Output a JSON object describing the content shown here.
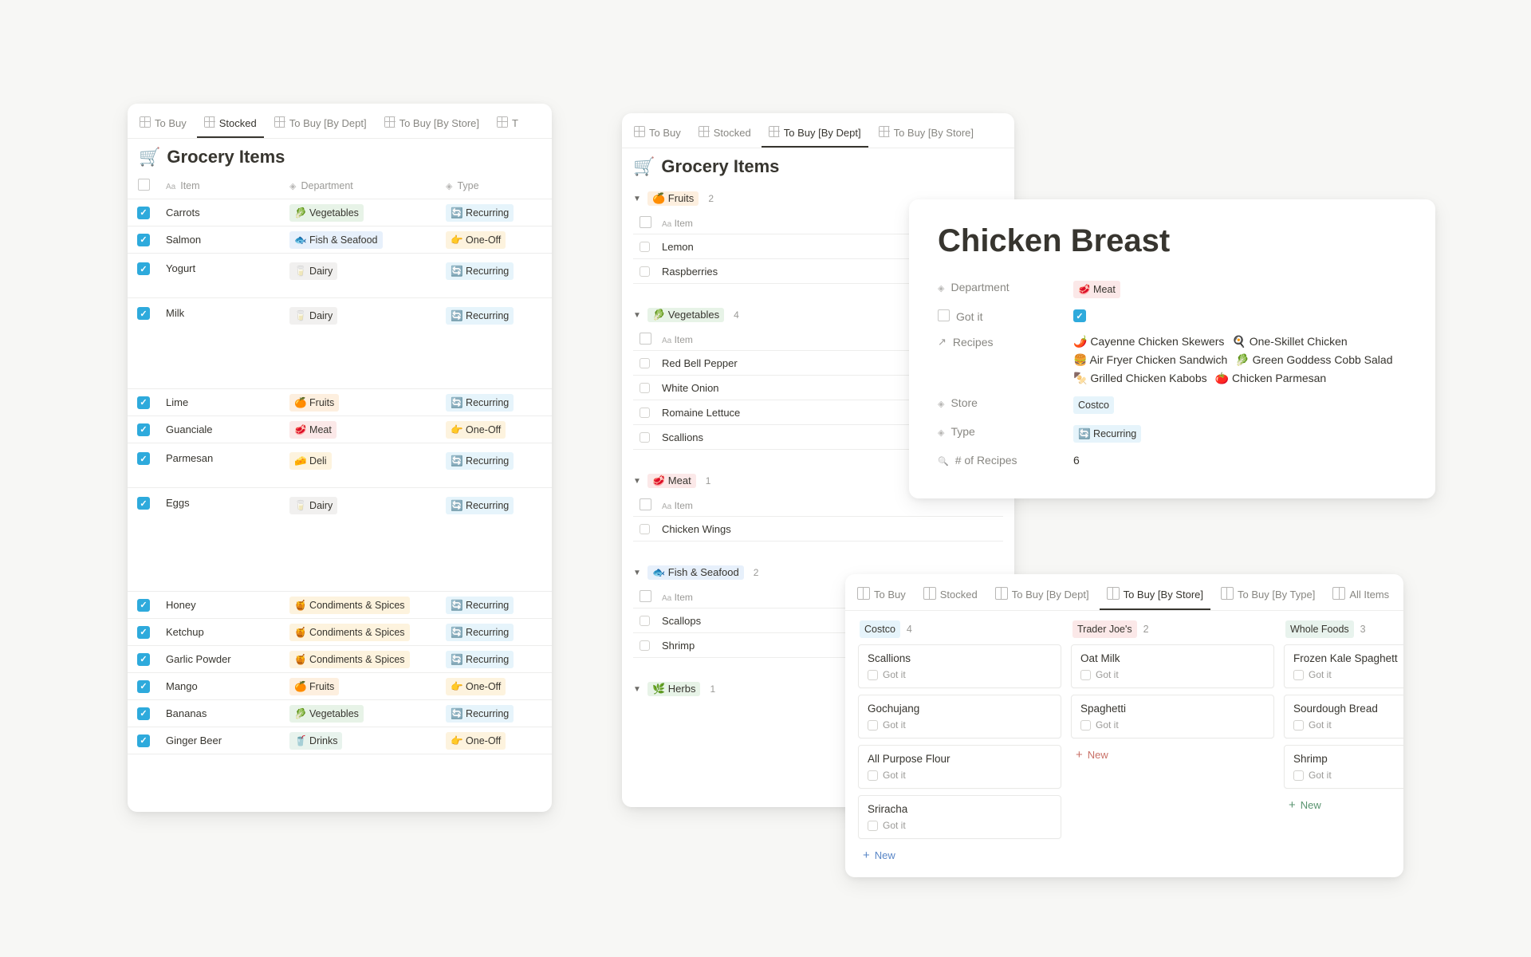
{
  "shared": {
    "title_emoji": "🛒",
    "title_text": "Grocery Items",
    "item_header": "Item",
    "got_it_label": "Got it",
    "new_label": "New"
  },
  "panel_stocked": {
    "tabs": [
      {
        "label": "To Buy",
        "active": false
      },
      {
        "label": "Stocked",
        "active": true
      },
      {
        "label": "To Buy [By Dept]",
        "active": false
      },
      {
        "label": "To Buy [By Store]",
        "active": false
      },
      {
        "label": "T",
        "active": false
      }
    ],
    "headers": {
      "item": "Item",
      "department": "Department",
      "type": "Type"
    },
    "rows": [
      {
        "checked": true,
        "item": "Carrots",
        "dept_emoji": "🥬",
        "dept": "Vegetables",
        "dept_class": "tag-vegetables",
        "type_emoji": "🔄",
        "type": "Recurring",
        "type_class": "tag-recurring"
      },
      {
        "checked": true,
        "item": "Salmon",
        "dept_emoji": "🐟",
        "dept": "Fish & Seafood",
        "dept_class": "tag-fish",
        "type_emoji": "👉",
        "type": "One-Off",
        "type_class": "tag-oneoff"
      },
      {
        "checked": true,
        "item": "Yogurt",
        "dept_emoji": "🥛",
        "dept": "Dairy",
        "dept_class": "tag-dairy",
        "type_emoji": "🔄",
        "type": "Recurring",
        "type_class": "tag-recurring",
        "row_class": "tall-med"
      },
      {
        "checked": true,
        "item": "Milk",
        "dept_emoji": "🥛",
        "dept": "Dairy",
        "dept_class": "tag-dairy",
        "type_emoji": "🔄",
        "type": "Recurring",
        "type_class": "tag-recurring",
        "row_class": "tall-2"
      },
      {
        "checked": true,
        "item": "Lime",
        "dept_emoji": "🍊",
        "dept": "Fruits",
        "dept_class": "tag-fruits",
        "type_emoji": "🔄",
        "type": "Recurring",
        "type_class": "tag-recurring"
      },
      {
        "checked": true,
        "item": "Guanciale",
        "dept_emoji": "🥩",
        "dept": "Meat",
        "dept_class": "tag-meat",
        "type_emoji": "👉",
        "type": "One-Off",
        "type_class": "tag-oneoff"
      },
      {
        "checked": true,
        "item": "Parmesan",
        "dept_emoji": "🧀",
        "dept": "Deli",
        "dept_class": "tag-deli",
        "type_emoji": "🔄",
        "type": "Recurring",
        "type_class": "tag-recurring",
        "row_class": "tall-med"
      },
      {
        "checked": true,
        "item": "Eggs",
        "dept_emoji": "🥛",
        "dept": "Dairy",
        "dept_class": "tag-dairy",
        "type_emoji": "🔄",
        "type": "Recurring",
        "type_class": "tag-recurring",
        "row_class": "tall-3"
      },
      {
        "checked": true,
        "item": "Honey",
        "dept_emoji": "🍯",
        "dept": "Condiments & Spices",
        "dept_class": "tag-condiments",
        "type_emoji": "🔄",
        "type": "Recurring",
        "type_class": "tag-recurring"
      },
      {
        "checked": true,
        "item": "Ketchup",
        "dept_emoji": "🍯",
        "dept": "Condiments & Spices",
        "dept_class": "tag-condiments",
        "type_emoji": "🔄",
        "type": "Recurring",
        "type_class": "tag-recurring"
      },
      {
        "checked": true,
        "item": "Garlic Powder",
        "dept_emoji": "🍯",
        "dept": "Condiments & Spices",
        "dept_class": "tag-condiments",
        "type_emoji": "🔄",
        "type": "Recurring",
        "type_class": "tag-recurring"
      },
      {
        "checked": true,
        "item": "Mango",
        "dept_emoji": "🍊",
        "dept": "Fruits",
        "dept_class": "tag-fruits",
        "type_emoji": "👉",
        "type": "One-Off",
        "type_class": "tag-oneoff"
      },
      {
        "checked": true,
        "item": "Bananas",
        "dept_emoji": "🥬",
        "dept": "Vegetables",
        "dept_class": "tag-vegetables",
        "type_emoji": "🔄",
        "type": "Recurring",
        "type_class": "tag-recurring"
      },
      {
        "checked": true,
        "item": "Ginger Beer",
        "dept_emoji": "🥤",
        "dept": "Drinks",
        "dept_class": "tag-drinks",
        "type_emoji": "👉",
        "type": "One-Off",
        "type_class": "tag-oneoff"
      }
    ]
  },
  "panel_dept": {
    "tabs": [
      {
        "label": "To Buy",
        "active": false
      },
      {
        "label": "Stocked",
        "active": false
      },
      {
        "label": "To Buy [By Dept]",
        "active": true
      },
      {
        "label": "To Buy [By Store]",
        "active": false
      }
    ],
    "groups": [
      {
        "emoji": "🍊",
        "name": "Fruits",
        "class": "tag-fruits",
        "count": 2,
        "rows": [
          "Lemon",
          "Raspberries"
        ]
      },
      {
        "emoji": "🥬",
        "name": "Vegetables",
        "class": "tag-vegetables",
        "count": 4,
        "rows": [
          "Red Bell Pepper",
          "White Onion",
          "Romaine Lettuce",
          "Scallions"
        ]
      },
      {
        "emoji": "🥩",
        "name": "Meat",
        "class": "tag-meat",
        "count": 1,
        "rows": [
          "Chicken Wings"
        ]
      },
      {
        "emoji": "🐟",
        "name": "Fish & Seafood",
        "class": "tag-fish",
        "count": 2,
        "rows": [
          "Scallops",
          "Shrimp"
        ]
      },
      {
        "emoji": "🌿",
        "name": "Herbs",
        "class": "tag-vegetables",
        "count": 1,
        "rows": []
      }
    ]
  },
  "panel_detail": {
    "title": "Chicken Breast",
    "labels": {
      "department": "Department",
      "got_it": "Got it",
      "recipes": "Recipes",
      "store": "Store",
      "type": "Type",
      "num_recipes": "# of Recipes"
    },
    "department": {
      "emoji": "🥩",
      "name": "Meat",
      "class": "tag-meat"
    },
    "got_it": true,
    "recipes": [
      {
        "emoji": "🌶️",
        "name": "Cayenne Chicken Skewers"
      },
      {
        "emoji": "🍳",
        "name": "One-Skillet Chicken"
      },
      {
        "emoji": "🍔",
        "name": "Air Fryer Chicken Sandwich"
      },
      {
        "emoji": "🥬",
        "name": "Green Goddess Cobb Salad"
      },
      {
        "emoji": "🍢",
        "name": "Grilled Chicken Kabobs"
      },
      {
        "emoji": "🍅",
        "name": "Chicken Parmesan"
      }
    ],
    "store": {
      "name": "Costco",
      "class": "tag-store-costco"
    },
    "type": {
      "emoji": "🔄",
      "name": "Recurring",
      "class": "tag-recurring"
    },
    "num_recipes": "6"
  },
  "panel_store": {
    "tabs": [
      {
        "label": "To Buy",
        "active": false
      },
      {
        "label": "Stocked",
        "active": false
      },
      {
        "label": "To Buy [By Dept]",
        "active": false
      },
      {
        "label": "To Buy [By Store]",
        "active": true
      },
      {
        "label": "To Buy [By Type]",
        "active": false
      },
      {
        "label": "All Items",
        "active": false
      }
    ],
    "columns": [
      {
        "name": "Costco",
        "class": "tag-store-costco",
        "count": 4,
        "new_class": "blue",
        "cards": [
          {
            "title": "Scallions",
            "got_it": false
          },
          {
            "title": "Gochujang",
            "got_it": false
          },
          {
            "title": "All Purpose Flour",
            "got_it": false
          },
          {
            "title": "Sriracha",
            "got_it": false
          }
        ]
      },
      {
        "name": "Trader Joe's",
        "class": "tag-store-tj",
        "count": 2,
        "new_class": "red",
        "cards": [
          {
            "title": "Oat Milk",
            "got_it": false
          },
          {
            "title": "Spaghetti",
            "got_it": false
          }
        ]
      },
      {
        "name": "Whole Foods",
        "class": "tag-store-wf",
        "count": 3,
        "new_class": "green",
        "cards": [
          {
            "title": "Frozen Kale Spaghett",
            "got_it": false
          },
          {
            "title": "Sourdough Bread",
            "got_it": false
          },
          {
            "title": "Shrimp",
            "got_it": false
          }
        ]
      }
    ]
  }
}
